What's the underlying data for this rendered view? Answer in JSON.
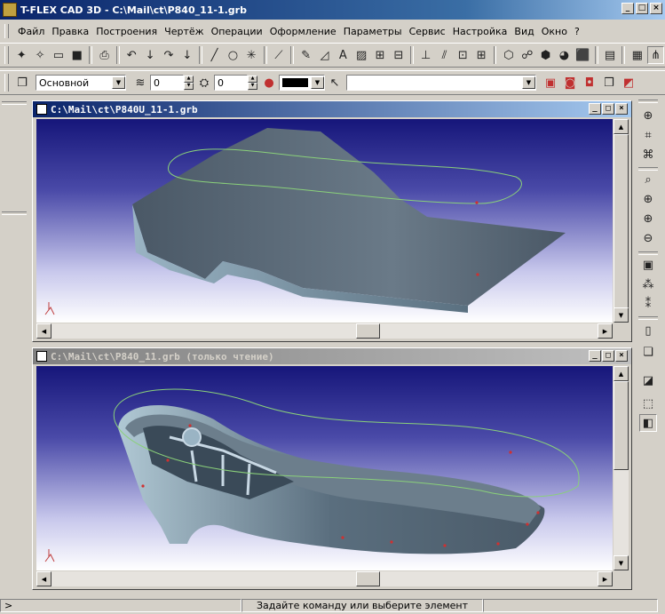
{
  "window": {
    "title": "T-FLEX CAD 3D - C:\\Mail\\ct\\P840_11-1.grb"
  },
  "menu": {
    "items": [
      "Файл",
      "Правка",
      "Построения",
      "Чертёж",
      "Операции",
      "Оформление",
      "Параметры",
      "Сервис",
      "Настройка",
      "Вид",
      "Окно",
      "?"
    ]
  },
  "toolbar2": {
    "layer": "Основной",
    "level_from": "0",
    "level_to": "0"
  },
  "doc1": {
    "title": "C:\\Mail\\ct\\P840U_11-1.grb"
  },
  "doc2": {
    "title": "C:\\Mail\\ct\\P840_11.grb (только чтение)"
  },
  "status": {
    "message": "Задайте команду или выберите элемент",
    "left_marker": ">"
  },
  "colors": {
    "title_active": "#0a246a",
    "title_inactive": "#808080",
    "viewport_top": "#16167a",
    "curve": "#8ad07a",
    "model": "#4a5a6a"
  }
}
